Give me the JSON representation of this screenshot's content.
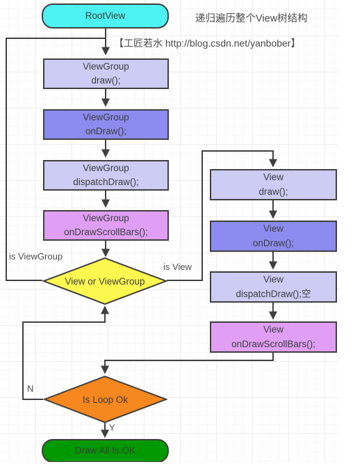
{
  "notes": {
    "title": "递归遍历整个View树结构",
    "credit": "【工匠若水 http://blog.csdn.net/yanbober】"
  },
  "colors": {
    "root": "#4df2f2",
    "light_lavender": "#ccccf5",
    "blue_purple": "#8c8cf0",
    "magenta": "#e09ff5",
    "decision_yellow": "#fdf84f",
    "decision_orange": "#f7871f",
    "terminal_green": "#009900",
    "stroke": "#3f3f3f",
    "text": "#3d3d3d"
  },
  "nodes": {
    "root": {
      "label": "RootView",
      "shape": "rounded",
      "fill": "#4df2f2"
    },
    "vg_draw": {
      "line1": "ViewGroup",
      "line2": "draw();",
      "shape": "rect",
      "fill": "#ccccf5"
    },
    "vg_ondraw": {
      "line1": "ViewGroup",
      "line2": "onDraw();",
      "shape": "rect",
      "fill": "#8c8cf0"
    },
    "vg_dispatchdraw": {
      "line1": "ViewGroup",
      "line2": "dispatchDraw();",
      "shape": "rect",
      "fill": "#ccccf5"
    },
    "vg_onscrollbars": {
      "line1": "ViewGroup",
      "line2": "onDrawScrollBars();",
      "shape": "rect",
      "fill": "#e09ff5"
    },
    "v_draw": {
      "line1": "View",
      "line2": "draw();",
      "shape": "rect",
      "fill": "#ccccf5"
    },
    "v_ondraw": {
      "line1": "View",
      "line2": "onDraw();",
      "shape": "rect",
      "fill": "#8c8cf0"
    },
    "v_dispatchdraw": {
      "line1": "View",
      "line2": "dispatchDraw();空",
      "shape": "rect",
      "fill": "#ccccf5"
    },
    "v_onscrollbars": {
      "line1": "View",
      "line2": "onDrawScrollBars();",
      "shape": "rect",
      "fill": "#e09ff5"
    },
    "decide_type": {
      "label": "View or ViewGroup",
      "shape": "diamond",
      "fill": "#fdf84f"
    },
    "decide_loop": {
      "label": "Is Loop Ok",
      "shape": "diamond",
      "fill": "#f7871f"
    },
    "terminal": {
      "label": "Draw All Is OK",
      "shape": "rounded",
      "fill": "#009900"
    }
  },
  "edge_labels": {
    "is_viewgroup": "is ViewGroup",
    "is_view": "is View",
    "loop_no": "N",
    "loop_yes": "Y"
  }
}
